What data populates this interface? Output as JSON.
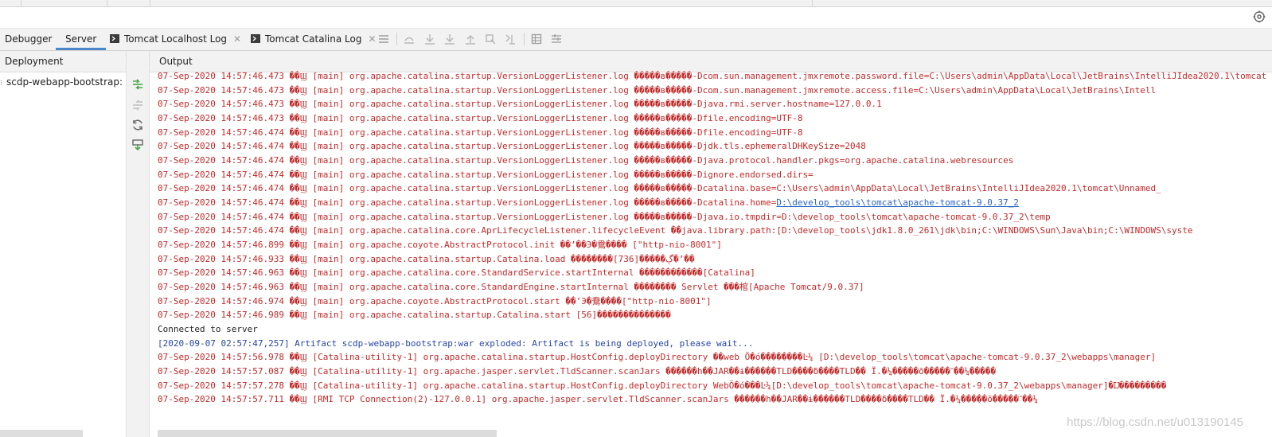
{
  "tabs": [
    {
      "label": "Debugger"
    },
    {
      "label": "Server",
      "active": true
    },
    {
      "label": "Tomcat Localhost Log",
      "icon": "console-icon",
      "closable": true
    },
    {
      "label": "Tomcat Catalina Log",
      "icon": "console-icon",
      "closable": true
    }
  ],
  "left_panel": {
    "header": "Deployment",
    "items": [
      {
        "label": "scdp-webapp-bootstrap:"
      }
    ]
  },
  "right_panel": {
    "header": "Output"
  },
  "log": [
    {
      "c": "red",
      "t": "07-Sep-2020 14:57:46.473 ��Ϣ [main] org.apache.catalina.startup.VersionLoggerListener.log �����в�����-Dcom.sun.management.jmxremote.password.file=C:\\Users\\admin\\AppData\\Local\\JetBrains\\IntelliJIdea2020.1\\tomcat"
    },
    {
      "c": "red",
      "t": "07-Sep-2020 14:57:46.473 ��Ϣ [main] org.apache.catalina.startup.VersionLoggerListener.log �����в�����-Dcom.sun.management.jmxremote.access.file=C:\\Users\\admin\\AppData\\Local\\JetBrains\\Intell"
    },
    {
      "c": "red",
      "t": "07-Sep-2020 14:57:46.473 ��Ϣ [main] org.apache.catalina.startup.VersionLoggerListener.log �����в�����-Djava.rmi.server.hostname=127.0.0.1"
    },
    {
      "c": "red",
      "t": "07-Sep-2020 14:57:46.473 ��Ϣ [main] org.apache.catalina.startup.VersionLoggerListener.log �����в�����-Dfile.encoding=UTF-8"
    },
    {
      "c": "red",
      "t": "07-Sep-2020 14:57:46.474 ��Ϣ [main] org.apache.catalina.startup.VersionLoggerListener.log �����в�����-Dfile.encoding=UTF-8"
    },
    {
      "c": "red",
      "t": "07-Sep-2020 14:57:46.474 ��Ϣ [main] org.apache.catalina.startup.VersionLoggerListener.log �����в�����-Djdk.tls.ephemeralDHKeySize=2048"
    },
    {
      "c": "red",
      "t": "07-Sep-2020 14:57:46.474 ��Ϣ [main] org.apache.catalina.startup.VersionLoggerListener.log �����в�����-Djava.protocol.handler.pkgs=org.apache.catalina.webresources"
    },
    {
      "c": "red",
      "t": "07-Sep-2020 14:57:46.474 ��Ϣ [main] org.apache.catalina.startup.VersionLoggerListener.log �����в�����-Dignore.endorsed.dirs="
    },
    {
      "c": "red",
      "t": "07-Sep-2020 14:57:46.474 ��Ϣ [main] org.apache.catalina.startup.VersionLoggerListener.log �����в�����-Dcatalina.base=C:\\Users\\admin\\AppData\\Local\\JetBrains\\IntelliJIdea2020.1\\tomcat\\Unnamed_"
    },
    {
      "c": "red",
      "t": "07-Sep-2020 14:57:46.474 ��Ϣ [main] org.apache.catalina.startup.VersionLoggerListener.log �����в�����-Dcatalina.home=",
      "link": "D:\\develop_tools\\tomcat\\apache-tomcat-9.0.37_2"
    },
    {
      "c": "red",
      "t": "07-Sep-2020 14:57:46.474 ��Ϣ [main] org.apache.catalina.startup.VersionLoggerListener.log �����в�����-Djava.io.tmpdir=D:\\develop_tools\\tomcat\\apache-tomcat-9.0.37_2\\temp"
    },
    {
      "c": "red",
      "t": "07-Sep-2020 14:57:46.474 ��Ϣ [main] org.apache.catalina.core.AprLifecycleListener.lifecycleEvent ��java.library.path:[D:\\develop_tools\\jdk1.8.0_261\\jdk\\bin;C:\\WINDOWS\\Sun\\Java\\bin;C:\\WINDOWS\\syste"
    },
    {
      "c": "red",
      "t": "07-Sep-2020 14:57:46.899 ��Ϣ [main] org.apache.coyote.AbstractProtocol.init ��ʼ��Э�鴦���� [\"http-nio-8001\"]"
    },
    {
      "c": "red",
      "t": "07-Sep-2020 14:57:46.933 ��Ϣ [main] org.apache.catalina.startup.Catalina.load ��������[736]�����ڳ�ʼ��"
    },
    {
      "c": "red",
      "t": "07-Sep-2020 14:57:46.963 ��Ϣ [main] org.apache.catalina.core.StandardService.startInternal ������������[Catalina]"
    },
    {
      "c": "red",
      "t": "07-Sep-2020 14:57:46.963 ��Ϣ [main] org.apache.catalina.core.StandardEngine.startInternal �������� Servlet ���棺[Apache Tomcat/9.0.37]"
    },
    {
      "c": "red",
      "t": "07-Sep-2020 14:57:46.974 ��Ϣ [main] org.apache.coyote.AbstractProtocol.start ��ʼЭ�鴦����[\"http-nio-8001\"]"
    },
    {
      "c": "red",
      "t": "07-Sep-2020 14:57:46.989 ��Ϣ [main] org.apache.catalina.startup.Catalina.start [56]��������������"
    },
    {
      "c": "black",
      "t": "Connected to server"
    },
    {
      "c": "blue",
      "t": "[2020-09-07 02:57:47,257] Artifact scdp-webapp-bootstrap:war exploded: Artifact is being deployed, please wait..."
    },
    {
      "c": "red",
      "t": "07-Sep-2020 14:57:56.978 ��Ϣ [Catalina-utility-1] org.apache.catalina.startup.HostConfig.deployDirectory ��web Ӧ�ó��������Ŀ¼ [D:\\develop_tools\\tomcat\\apache-tomcat-9.0.37_2\\webapps\\manager]"
    },
    {
      "c": "red",
      "t": "07-Sep-2020 14:57:57.087 ��Ϣ [Catalina-utility-1] org.apache.jasper.servlet.TldScanner.scanJars ������һ��JAR��ɨ������TLD����δ����TLD�� Ϊ.�¼�����õ�����־��¼�����"
    },
    {
      "c": "red",
      "t": "07-Sep-2020 14:57:57.278 ��Ϣ [Catalina-utility-1] org.apache.catalina.startup.HostConfig.deployDirectory WebӦ�ó���Ŀ¼[D:\\develop_tools\\tomcat\\apache-tomcat-9.0.37_2\\webapps\\manager]�Ĳ���������"
    },
    {
      "c": "red",
      "t": "07-Sep-2020 14:57:57.711 ��Ϣ [RMI TCP Connection(2)-127.0.0.1] org.apache.jasper.servlet.TldScanner.scanJars ������һ��JAR��ɨ������TLD����δ����TLD�� Ϊ.�¼�����õ�����־��¼"
    }
  ],
  "watermark": "https://blog.csdn.net/u013190145"
}
